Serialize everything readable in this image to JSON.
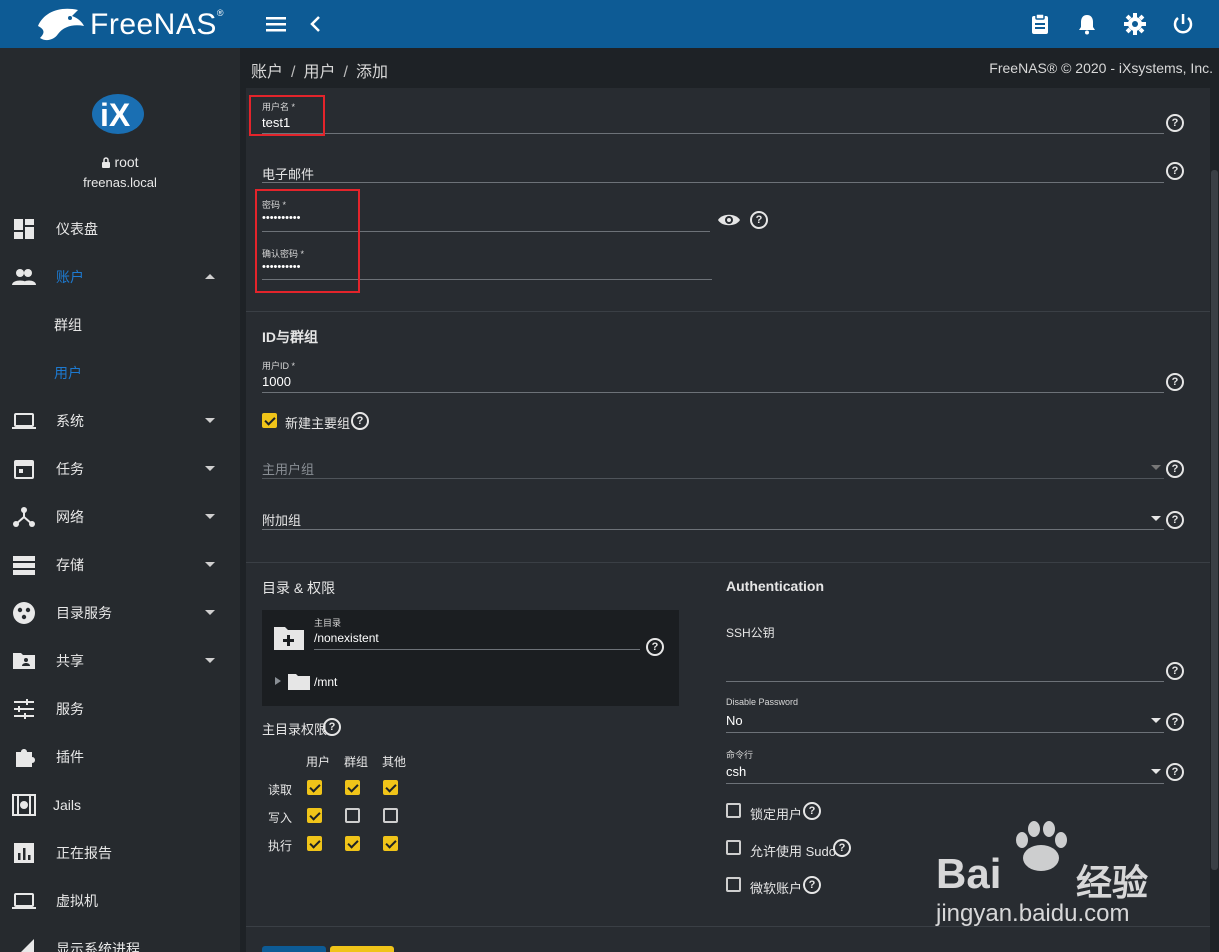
{
  "brand": {
    "name": "FreeNAS",
    "mark": "®"
  },
  "user": {
    "name": "root",
    "host": "freenas.local"
  },
  "nav": {
    "dashboard": "仪表盘",
    "accounts": "账户",
    "groups": "群组",
    "users": "用户",
    "system": "系统",
    "tasks": "任务",
    "network": "网络",
    "storage": "存储",
    "directory_services": "目录服务",
    "sharing": "共享",
    "services": "服务",
    "plugins": "插件",
    "jails": "Jails",
    "reporting": "正在报告",
    "vm": "虚拟机",
    "processes": "显示系统进程"
  },
  "breadcrumb": {
    "part1": "账户",
    "part2": "用户",
    "part3": "添加",
    "sep": "/"
  },
  "copyright": "FreeNAS® © 2020 - iXsystems, Inc.",
  "form": {
    "username_label": "用户名 *",
    "username_value": "test1",
    "email_label": "电子邮件",
    "password_label": "密码 *",
    "password_value": "••••••••••",
    "confirm_label": "确认密码 *",
    "confirm_value": "••••••••••",
    "id_section": "ID与群组",
    "uid_label": "用户ID *",
    "uid_value": "1000",
    "new_primary_group": "新建主要组",
    "primary_group": "主用户组",
    "aux_groups": "附加组",
    "dir_section": "目录 & 权限",
    "home_dir_label": "主目录",
    "home_dir_value": "/nonexistent",
    "tree_node": "/mnt",
    "home_perm_label": "主目录权限",
    "perm_cols": [
      "用户",
      "群组",
      "其他"
    ],
    "perm_rows": [
      "读取",
      "写入",
      "执行"
    ],
    "auth_section": "Authentication",
    "ssh_label": "SSH公钥",
    "disable_pw_label": "Disable Password",
    "disable_pw_value": "No",
    "shell_label": "命令行",
    "shell_value": "csh",
    "lock_user": "锁定用户",
    "allow_sudo": "允许使用 Sudo",
    "microsoft_account": "微软账户"
  },
  "watermark": {
    "brand": "Bai",
    "brand2": "经验",
    "url": "jingyan.baidu.com"
  },
  "colors": {
    "topbar": "#0d5b95",
    "sidebar": "#262a2e",
    "card": "#282c31",
    "accent": "#f0c419",
    "active_nav": "#1d7ad1",
    "highlight_box": "#e3242b"
  }
}
